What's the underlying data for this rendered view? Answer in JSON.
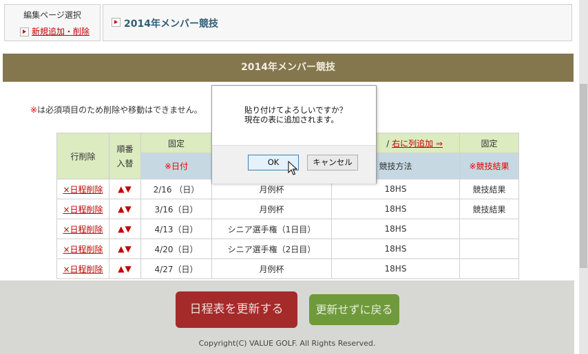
{
  "header": {
    "select_caption": "編集ページ選択",
    "new_link": "新規追加・削除",
    "page_title": "2014年メンバー競技"
  },
  "banner": "2014年メンバー競技",
  "notice": {
    "mark": "※",
    "text": "は必須項目のため削除や移動はできません。"
  },
  "table": {
    "col_delete": "行削除",
    "col_order_top": "順番",
    "col_order_bottom": "入替",
    "fixed_left": "固定",
    "add_right_sep": "/",
    "add_right": "右に列追加 ⇒",
    "fixed_right": "固定",
    "hdr_date": "※日付",
    "hdr_method": "競技方法",
    "hdr_result": "※競技結果",
    "delete_label": "×日程削除",
    "arrows": "▲▼",
    "rows": [
      {
        "date": "2/16 （日）",
        "event": "月例杯",
        "method": "18HS",
        "result": "競技結果"
      },
      {
        "date": "3/16（日）",
        "event": "月例杯",
        "method": "18HS",
        "result": "競技結果"
      },
      {
        "date": "4/13（日）",
        "event": "シニア選手権（1日目）",
        "method": "18HS",
        "result": ""
      },
      {
        "date": "4/20（日）",
        "event": "シニア選手権（2日目）",
        "method": "18HS",
        "result": ""
      },
      {
        "date": "4/27（日）",
        "event": "月例杯",
        "method": "18HS",
        "result": ""
      }
    ]
  },
  "footer": {
    "update_button": "日程表を更新する",
    "back_button": "更新せずに戻る",
    "copyright": "Copyright(C) VALUE GOLF. All Rights Reserved."
  },
  "dialog": {
    "line1": "貼り付けてよろしいですか？",
    "line2": "現在の表に追加されます。",
    "ok": "OK",
    "cancel": "キャンセル"
  },
  "colors": {
    "banner": "#84774e",
    "update_button": "#a52a2a",
    "back_button": "#6f9a3b",
    "link_red": "#c00000"
  },
  "icons": [
    "triangle-bullet-icon",
    "mouse-cursor-icon"
  ]
}
